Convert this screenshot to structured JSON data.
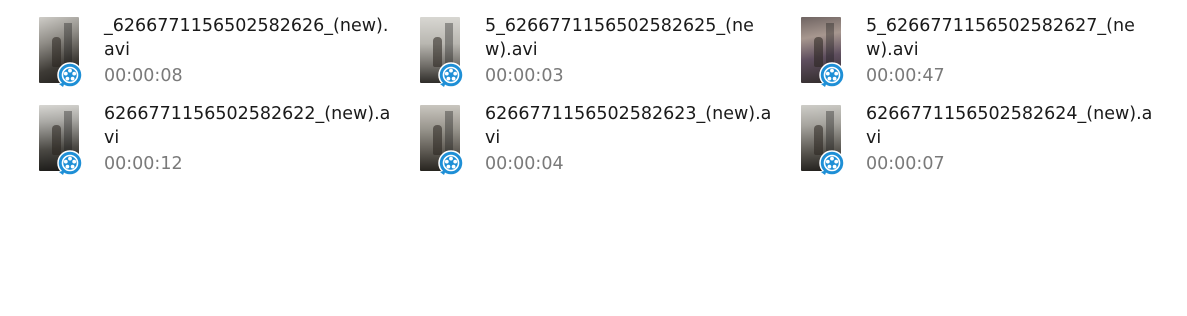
{
  "files": [
    {
      "name": "_6266771156502582626_(new).avi",
      "duration": "00:00:08",
      "icon": "video-file-icon"
    },
    {
      "name": "5_6266771156502582625_(new).avi",
      "duration": "00:00:03",
      "icon": "video-file-icon"
    },
    {
      "name": "5_6266771156502582627_(new).avi",
      "duration": "00:00:47",
      "icon": "video-file-icon"
    },
    {
      "name": "6266771156502582622_(new).avi",
      "duration": "00:00:12",
      "icon": "video-file-icon"
    },
    {
      "name": "6266771156502582623_(new).avi",
      "duration": "00:00:04",
      "icon": "video-file-icon"
    },
    {
      "name": "6266771156502582624_(new).avi",
      "duration": "00:00:07",
      "icon": "video-file-icon"
    }
  ],
  "colors": {
    "name_text": "#1a1a1a",
    "duration_text": "#7a7a7a",
    "badge_blue": "#1e8fd6",
    "background": "#ffffff"
  }
}
